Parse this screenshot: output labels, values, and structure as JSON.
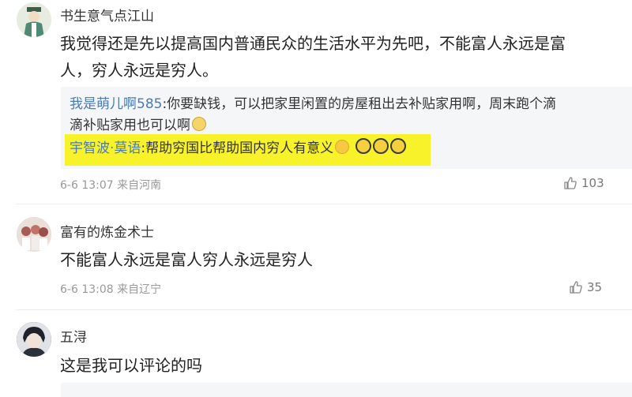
{
  "comments": [
    {
      "username": "书生意气点江山",
      "content_line1": "我觉得还是先以提高国内普通民众的生活水平为先吧，不能富人永远是富",
      "content_line2": "人，穷人永远是穷人。",
      "replies": [
        {
          "name": "我是萌儿啊585",
          "text_line1": ":你要缺钱，可以把家里闲置的房屋租出去补贴家用啊，周末跑个滴",
          "text_line2": "滴补贴家用也可以啊"
        },
        {
          "name": "宇智波·莫语",
          "text": ":帮助穷国比帮助国内穷人有意义"
        }
      ],
      "time": "6-6 13:07",
      "location": "来自河南",
      "likes": "103"
    },
    {
      "username": "富有的炼金术士",
      "content": "不能富人永远是富人穷人永远是穷人",
      "time": "6-6 13:08",
      "location": "来自辽宁",
      "likes": "35"
    },
    {
      "username": "五浔",
      "content": "这是我可以评论的吗"
    }
  ],
  "icons": {
    "like": "thumbs-up-icon",
    "emoji_1": "dizzy-face-emoji",
    "emoji_2": "shocked-face-emoji"
  },
  "colors": {
    "reply_name": "#4a7ab8",
    "highlight": "#f7f22a",
    "reply_bg": "#f4f6f8"
  }
}
